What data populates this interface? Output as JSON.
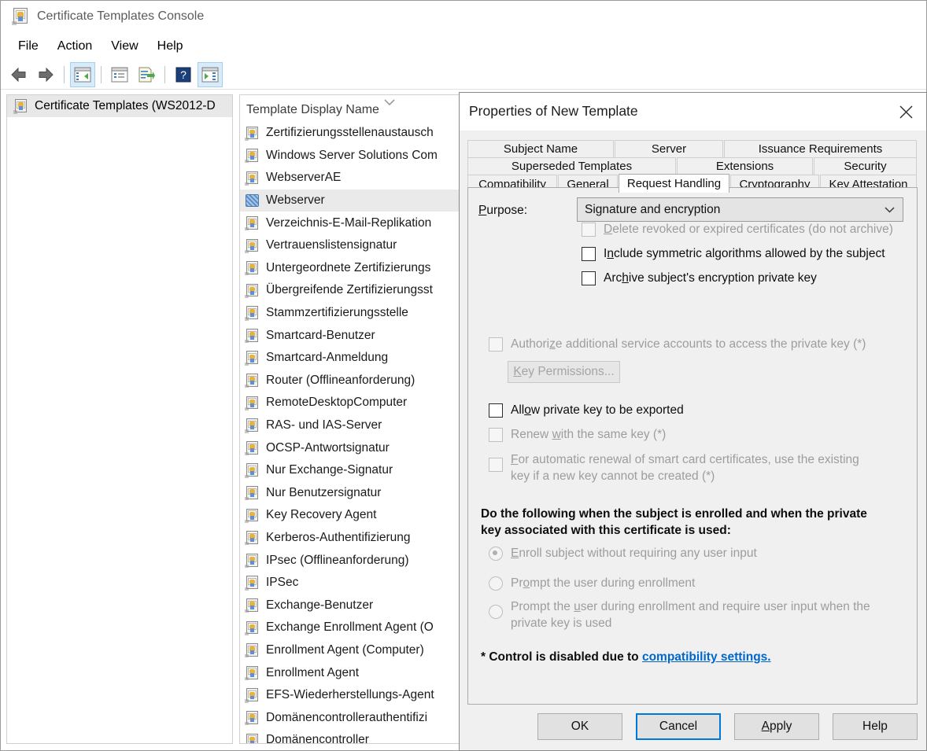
{
  "window": {
    "title": "Certificate Templates Console",
    "icon": "certificate-template-icon",
    "menu": [
      "File",
      "Action",
      "View",
      "Help"
    ],
    "toolbar": [
      {
        "name": "back-icon",
        "glyph": "←",
        "selected": false
      },
      {
        "name": "forward-icon",
        "glyph": "→",
        "selected": false
      },
      {
        "name": "show-hide-tree-icon",
        "glyph": "▤",
        "selected": true
      },
      {
        "name": "properties-icon",
        "glyph": "▥",
        "selected": false
      },
      {
        "name": "export-list-icon",
        "glyph": "▦",
        "selected": false
      },
      {
        "name": "help-icon",
        "glyph": "?",
        "selected": false
      },
      {
        "name": "show-hide-action-pane-icon",
        "glyph": "▶",
        "selected": true
      }
    ]
  },
  "tree": {
    "root_label": "Certificate Templates (WS2012-D",
    "root_icon": "certificate-template-icon"
  },
  "list": {
    "column_header": "Template Display Name",
    "sort_indicator": "chevron-up-sort-icon",
    "selected_index": 3,
    "items": [
      "Zertifizierungsstellenaustausch",
      "Windows Server Solutions Com",
      "WebserverAE",
      "Webserver",
      "Verzeichnis-E-Mail-Replikation",
      "Vertrauenslistensignatur",
      "Untergeordnete Zertifizierungs",
      "Übergreifende Zertifizierungsst",
      "Stammzertifizierungsstelle",
      "Smartcard-Benutzer",
      "Smartcard-Anmeldung",
      "Router (Offlineanforderung)",
      "RemoteDesktopComputer",
      "RAS- und IAS-Server",
      "OCSP-Antwortsignatur",
      "Nur Exchange-Signatur",
      "Nur Benutzersignatur",
      "Key Recovery Agent",
      "Kerberos-Authentifizierung",
      "IPsec (Offlineanforderung)",
      "IPSec",
      "Exchange-Benutzer",
      "Exchange Enrollment Agent (O",
      "Enrollment Agent (Computer)",
      "Enrollment Agent",
      "EFS-Wiederherstellungs-Agent",
      "Domänencontrollerauthentifizi",
      "Domänencontroller"
    ]
  },
  "dialog": {
    "title": "Properties of New Template",
    "close_icon": "close-icon",
    "tabs_row1": [
      "Subject Name",
      "Server",
      "Issuance Requirements"
    ],
    "tabs_row2": [
      "Superseded Templates",
      "Extensions",
      "Security"
    ],
    "tabs_row3": [
      "Compatibility",
      "General",
      "Request Handling",
      "Cryptography",
      "Key Attestation"
    ],
    "active_tab": "Request Handling",
    "purpose": {
      "label": "Purpose:",
      "label_accel": "P",
      "value": "Signature and encryption",
      "dropdown_icon": "chevron-down-icon"
    },
    "checkboxes": [
      {
        "accel": "D",
        "pre": "",
        "post": "elete revoked or expired certificates (do not archive)",
        "checked": false,
        "disabled": true
      },
      {
        "accel": "n",
        "pre": "I",
        "post": "clude symmetric algorithms allowed by the subject",
        "checked": false,
        "disabled": false
      },
      {
        "accel": "h",
        "pre": "Arc",
        "post": "ive subject's encryption private key",
        "checked": false,
        "disabled": false
      },
      {
        "accel": "z",
        "pre": "Authori",
        "post": "e additional service accounts to access the private key (*)",
        "checked": false,
        "disabled": true
      },
      {
        "accel": "o",
        "pre": "All",
        "post": "w private key to be exported",
        "checked": false,
        "disabled": false
      },
      {
        "accel": "w",
        "pre": "Renew ",
        "post": "ith the same key (*)",
        "checked": false,
        "disabled": true
      },
      {
        "accel": "F",
        "pre": "",
        "post": "or automatic renewal of smart card certificates, use the existing key if a new key cannot be created (*)",
        "checked": false,
        "disabled": true
      }
    ],
    "key_permissions_button": {
      "accel": "K",
      "pre": "",
      "post": "ey Permissions...",
      "disabled": true
    },
    "enrollment_heading": "Do the following when the subject is enrolled and when the private key associated with this certificate is used:",
    "radios": [
      {
        "accel": "E",
        "pre": "",
        "post": "nroll subject without requiring any user input",
        "selected": true,
        "disabled": true
      },
      {
        "accel": "o",
        "pre": "Pr",
        "post": "mpt the user during enrollment",
        "selected": false,
        "disabled": true
      },
      {
        "accel": "u",
        "pre": "Prompt the ",
        "post": "ser during enrollment and require user input when the private key is used",
        "selected": false,
        "disabled": true
      }
    ],
    "footnote_prefix": "* Control is disabled due to ",
    "footnote_link": "compatibility settings.",
    "buttons": [
      {
        "name": "ok-button",
        "label": "OK",
        "accel": "",
        "focused": false
      },
      {
        "name": "cancel-button",
        "label": "Cancel",
        "accel": "",
        "focused": true
      },
      {
        "name": "apply-button",
        "label": "Apply",
        "accel": "A",
        "focused": false
      },
      {
        "name": "help-button",
        "label": "Help",
        "accel": "",
        "focused": false
      }
    ]
  },
  "colors": {
    "dialog_bg": "#f0f0f0",
    "accent_focus": "#0078d7",
    "link": "#0066cc",
    "selection": "#eaeaea"
  }
}
